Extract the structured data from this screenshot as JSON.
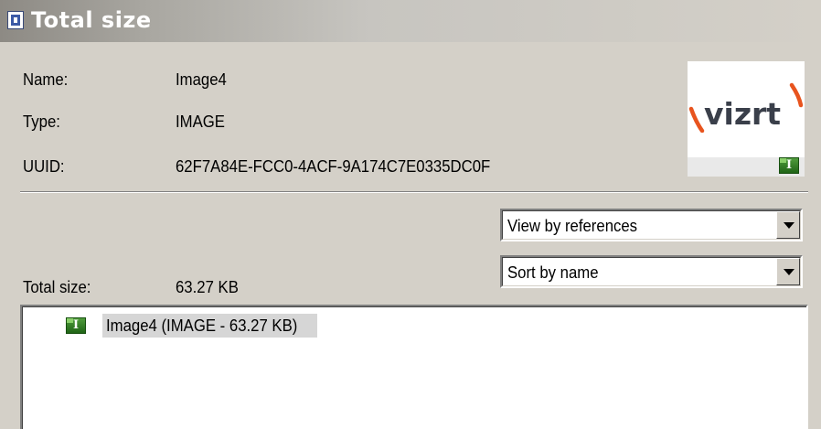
{
  "window": {
    "title": "Total size",
    "title_icon": "document-icon"
  },
  "info": {
    "name_label": "Name:",
    "name_value": "Image4",
    "type_label": "Type:",
    "type_value": "IMAGE",
    "uuid_label": "UUID:",
    "uuid_value": "62F7A84E-FCC0-4ACF-9A174C7E0335DC0F"
  },
  "preview": {
    "logo_text": "vizrt",
    "badge_icon": "image-type-icon",
    "badge_letter": "I"
  },
  "view_select": {
    "value": "View by references"
  },
  "sort_select": {
    "value": "Sort by name"
  },
  "total": {
    "label": "Total size:",
    "value": "63.27 KB"
  },
  "tree": {
    "items": [
      {
        "label": "Image4 (IMAGE - 63.27 KB)",
        "icon": "image-type-icon",
        "badge_letter": "I",
        "selected": true
      }
    ]
  },
  "colors": {
    "window_bg": "#d4d0c8",
    "logo_orange": "#e8541e",
    "logo_text": "#3a3f4a",
    "badge_green": "#2f7d22"
  }
}
